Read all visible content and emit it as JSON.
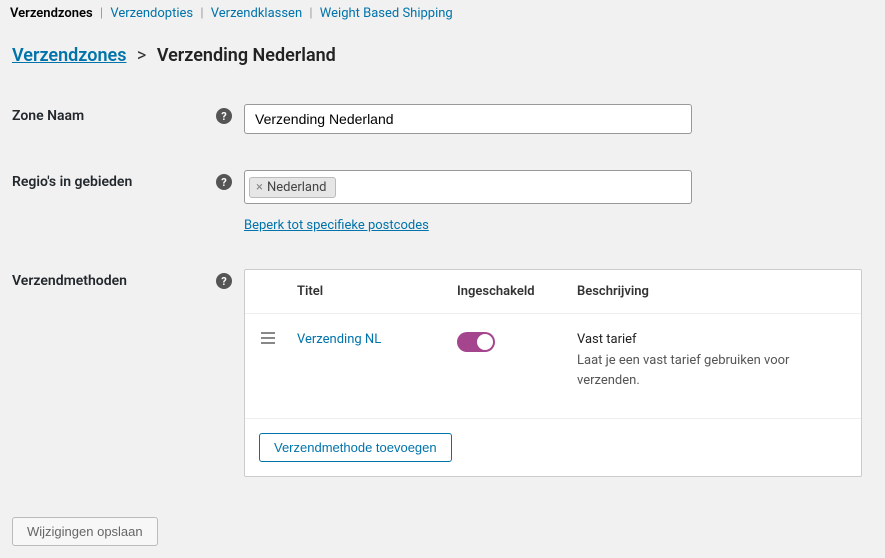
{
  "tabs": {
    "items": [
      {
        "label": "Verzendzones",
        "active": true
      },
      {
        "label": "Verzendopties",
        "active": false
      },
      {
        "label": "Verzendklassen",
        "active": false
      },
      {
        "label": "Weight Based Shipping",
        "active": false
      }
    ]
  },
  "breadcrumb": {
    "root": "Verzendzones",
    "current": "Verzending Nederland"
  },
  "fields": {
    "zone_name_label": "Zone Naam",
    "zone_name_value": "Verzending Nederland",
    "regions_label": "Regio's in gebieden",
    "regions_tags": [
      "Nederland"
    ],
    "postcode_link": "Beperk tot specifieke postcodes",
    "methods_label": "Verzendmethoden"
  },
  "methods_table": {
    "columns": {
      "title": "Titel",
      "enabled": "Ingeschakeld",
      "description": "Beschrijving"
    },
    "rows": [
      {
        "title": "Verzending NL",
        "enabled": true,
        "desc_title": "Vast tarief",
        "desc_text": "Laat je een vast tarief gebruiken voor verzenden."
      }
    ],
    "add_button": "Verzendmethode toevoegen"
  },
  "save_button": "Wijzigingen opslaan"
}
